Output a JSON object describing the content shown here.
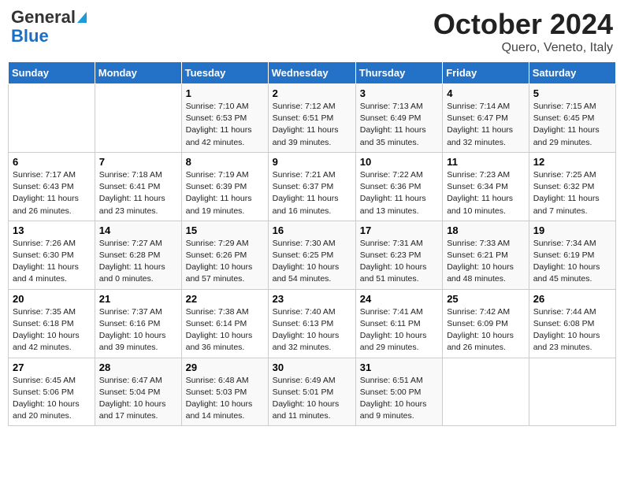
{
  "header": {
    "logo_line1": "General",
    "logo_line2": "Blue",
    "title": "October 2024",
    "subtitle": "Quero, Veneto, Italy"
  },
  "days_of_week": [
    "Sunday",
    "Monday",
    "Tuesday",
    "Wednesday",
    "Thursday",
    "Friday",
    "Saturday"
  ],
  "weeks": [
    [
      {
        "day": "",
        "info": ""
      },
      {
        "day": "",
        "info": ""
      },
      {
        "day": "1",
        "info": "Sunrise: 7:10 AM\nSunset: 6:53 PM\nDaylight: 11 hours and 42 minutes."
      },
      {
        "day": "2",
        "info": "Sunrise: 7:12 AM\nSunset: 6:51 PM\nDaylight: 11 hours and 39 minutes."
      },
      {
        "day": "3",
        "info": "Sunrise: 7:13 AM\nSunset: 6:49 PM\nDaylight: 11 hours and 35 minutes."
      },
      {
        "day": "4",
        "info": "Sunrise: 7:14 AM\nSunset: 6:47 PM\nDaylight: 11 hours and 32 minutes."
      },
      {
        "day": "5",
        "info": "Sunrise: 7:15 AM\nSunset: 6:45 PM\nDaylight: 11 hours and 29 minutes."
      }
    ],
    [
      {
        "day": "6",
        "info": "Sunrise: 7:17 AM\nSunset: 6:43 PM\nDaylight: 11 hours and 26 minutes."
      },
      {
        "day": "7",
        "info": "Sunrise: 7:18 AM\nSunset: 6:41 PM\nDaylight: 11 hours and 23 minutes."
      },
      {
        "day": "8",
        "info": "Sunrise: 7:19 AM\nSunset: 6:39 PM\nDaylight: 11 hours and 19 minutes."
      },
      {
        "day": "9",
        "info": "Sunrise: 7:21 AM\nSunset: 6:37 PM\nDaylight: 11 hours and 16 minutes."
      },
      {
        "day": "10",
        "info": "Sunrise: 7:22 AM\nSunset: 6:36 PM\nDaylight: 11 hours and 13 minutes."
      },
      {
        "day": "11",
        "info": "Sunrise: 7:23 AM\nSunset: 6:34 PM\nDaylight: 11 hours and 10 minutes."
      },
      {
        "day": "12",
        "info": "Sunrise: 7:25 AM\nSunset: 6:32 PM\nDaylight: 11 hours and 7 minutes."
      }
    ],
    [
      {
        "day": "13",
        "info": "Sunrise: 7:26 AM\nSunset: 6:30 PM\nDaylight: 11 hours and 4 minutes."
      },
      {
        "day": "14",
        "info": "Sunrise: 7:27 AM\nSunset: 6:28 PM\nDaylight: 11 hours and 0 minutes."
      },
      {
        "day": "15",
        "info": "Sunrise: 7:29 AM\nSunset: 6:26 PM\nDaylight: 10 hours and 57 minutes."
      },
      {
        "day": "16",
        "info": "Sunrise: 7:30 AM\nSunset: 6:25 PM\nDaylight: 10 hours and 54 minutes."
      },
      {
        "day": "17",
        "info": "Sunrise: 7:31 AM\nSunset: 6:23 PM\nDaylight: 10 hours and 51 minutes."
      },
      {
        "day": "18",
        "info": "Sunrise: 7:33 AM\nSunset: 6:21 PM\nDaylight: 10 hours and 48 minutes."
      },
      {
        "day": "19",
        "info": "Sunrise: 7:34 AM\nSunset: 6:19 PM\nDaylight: 10 hours and 45 minutes."
      }
    ],
    [
      {
        "day": "20",
        "info": "Sunrise: 7:35 AM\nSunset: 6:18 PM\nDaylight: 10 hours and 42 minutes."
      },
      {
        "day": "21",
        "info": "Sunrise: 7:37 AM\nSunset: 6:16 PM\nDaylight: 10 hours and 39 minutes."
      },
      {
        "day": "22",
        "info": "Sunrise: 7:38 AM\nSunset: 6:14 PM\nDaylight: 10 hours and 36 minutes."
      },
      {
        "day": "23",
        "info": "Sunrise: 7:40 AM\nSunset: 6:13 PM\nDaylight: 10 hours and 32 minutes."
      },
      {
        "day": "24",
        "info": "Sunrise: 7:41 AM\nSunset: 6:11 PM\nDaylight: 10 hours and 29 minutes."
      },
      {
        "day": "25",
        "info": "Sunrise: 7:42 AM\nSunset: 6:09 PM\nDaylight: 10 hours and 26 minutes."
      },
      {
        "day": "26",
        "info": "Sunrise: 7:44 AM\nSunset: 6:08 PM\nDaylight: 10 hours and 23 minutes."
      }
    ],
    [
      {
        "day": "27",
        "info": "Sunrise: 6:45 AM\nSunset: 5:06 PM\nDaylight: 10 hours and 20 minutes."
      },
      {
        "day": "28",
        "info": "Sunrise: 6:47 AM\nSunset: 5:04 PM\nDaylight: 10 hours and 17 minutes."
      },
      {
        "day": "29",
        "info": "Sunrise: 6:48 AM\nSunset: 5:03 PM\nDaylight: 10 hours and 14 minutes."
      },
      {
        "day": "30",
        "info": "Sunrise: 6:49 AM\nSunset: 5:01 PM\nDaylight: 10 hours and 11 minutes."
      },
      {
        "day": "31",
        "info": "Sunrise: 6:51 AM\nSunset: 5:00 PM\nDaylight: 10 hours and 9 minutes."
      },
      {
        "day": "",
        "info": ""
      },
      {
        "day": "",
        "info": ""
      }
    ]
  ]
}
